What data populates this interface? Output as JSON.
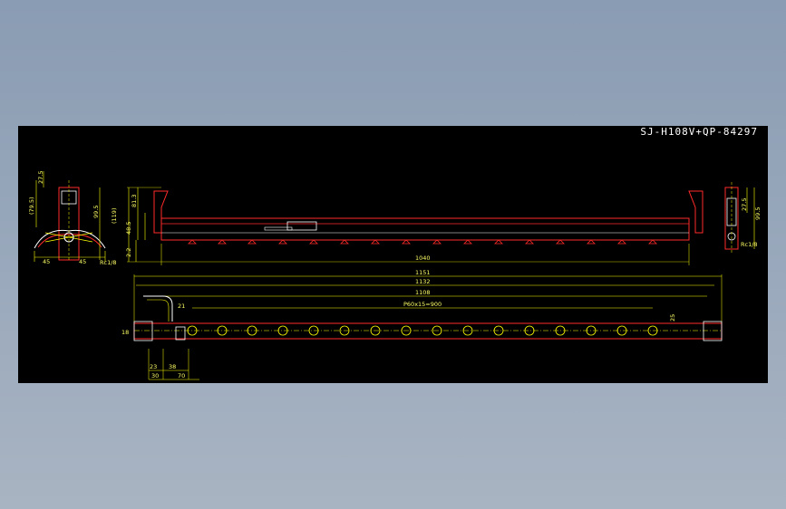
{
  "title": "SJ-H108V+QP-84297",
  "colors": {
    "background": "#000000",
    "dimension": "#ffff00",
    "outline": "#ff2a2a",
    "highlight": "#ffffff",
    "frame": "#9aa9bc"
  },
  "dims": {
    "left_view": {
      "top": "27.5",
      "side": "(79.5)",
      "height": "99.5",
      "left_width": "45",
      "right_width": "45",
      "thread": "Rc1/8"
    },
    "front_view": {
      "h1": "81.3",
      "h2": "(119)",
      "h3": "48.5",
      "h4": "2.2",
      "length": "1040"
    },
    "right_view": {
      "top": "27.5",
      "height": "99.5",
      "thread": "Rc1/8"
    },
    "top_view": {
      "l1": "1151",
      "l2": "1132",
      "l3": "1108",
      "pitch": "P60x15=900",
      "d21": "21",
      "d23": "23",
      "d38": "38",
      "d30": "30",
      "d70": "70",
      "d18": "18",
      "d25": "25"
    }
  }
}
